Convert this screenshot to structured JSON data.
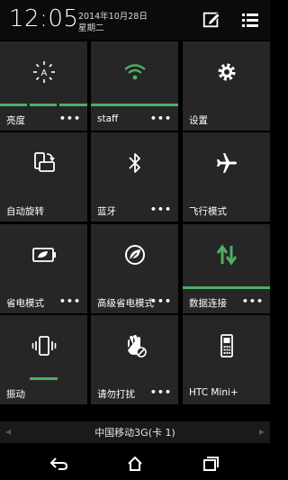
{
  "status": {
    "time": "12:05",
    "date": "2014年10月28日",
    "weekday": "星期二"
  },
  "tiles": [
    {
      "label": "亮度",
      "more": "•••",
      "icon": "brightness-auto-icon",
      "bar": "segmented"
    },
    {
      "label": "staff",
      "more": "•••",
      "icon": "wifi-icon",
      "bar": "full",
      "accent": "#4caf66"
    },
    {
      "label": "设置",
      "more": "",
      "icon": "gear-icon",
      "bar": "none"
    },
    {
      "label": "自动旋转",
      "more": "",
      "icon": "auto-rotate-icon",
      "bar": "none"
    },
    {
      "label": "蓝牙",
      "more": "•••",
      "icon": "bluetooth-icon",
      "bar": "none"
    },
    {
      "label": "飞行模式",
      "more": "",
      "icon": "airplane-icon",
      "bar": "none"
    },
    {
      "label": "省电模式",
      "more": "•••",
      "icon": "power-saver-icon",
      "bar": "none"
    },
    {
      "label": "高级省电模式",
      "more": "•••",
      "icon": "extreme-power-saver-icon",
      "bar": "none"
    },
    {
      "label": "数据连接",
      "more": "•••",
      "icon": "data-arrows-icon",
      "bar": "full",
      "accent": "#4caf66"
    },
    {
      "label": "振动",
      "more": "",
      "icon": "vibrate-icon",
      "bar": "partial"
    },
    {
      "label": "请勿打扰",
      "more": "•••",
      "icon": "do-not-disturb-icon",
      "bar": "none"
    },
    {
      "label": "HTC Mini+",
      "more": "",
      "icon": "phone-icon",
      "bar": "none"
    }
  ],
  "carrier": {
    "label": "中国移动3G(卡 1)"
  },
  "nav": [
    "back-icon",
    "home-icon",
    "recents-icon"
  ]
}
